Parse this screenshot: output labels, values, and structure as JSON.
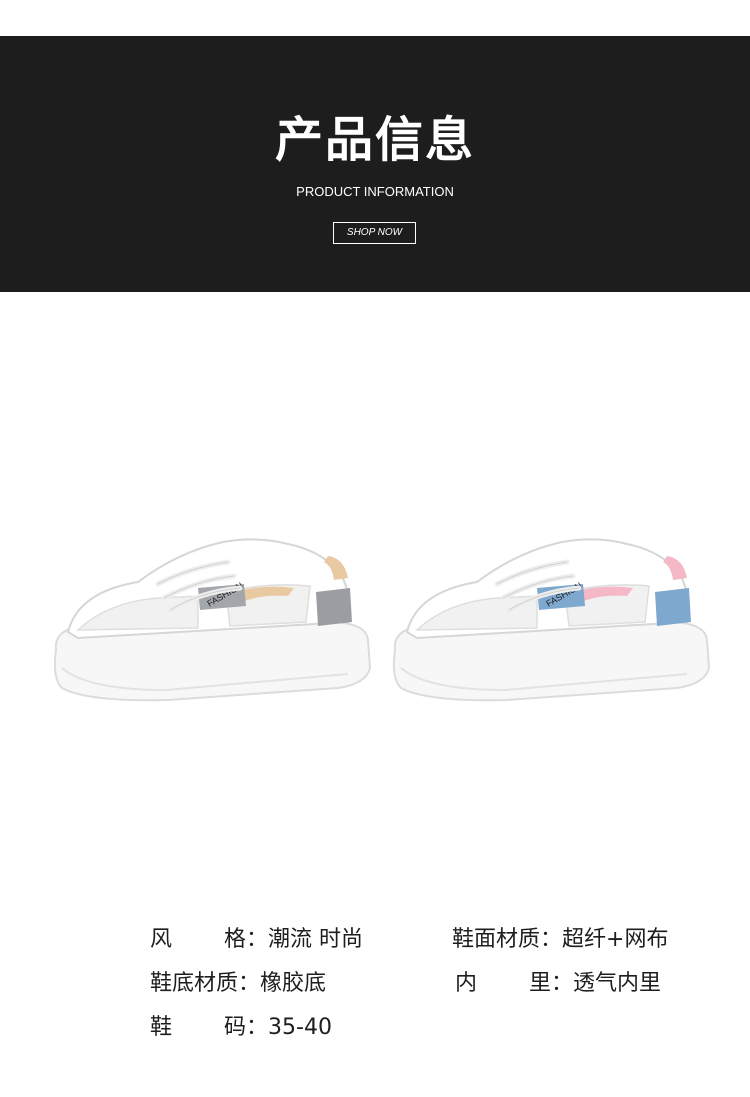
{
  "banner": {
    "title": "产品信息",
    "subtitle": "PRODUCT INFORMATION",
    "button_label": "SHOP NOW"
  },
  "products": [
    {
      "tag": "FASHION",
      "accent": "#e9c9a2",
      "heel": "#9a9da1"
    },
    {
      "tag": "FASHION",
      "accent": "#f4b8c6",
      "heel": "#7fa8cf"
    }
  ],
  "specs": {
    "style": {
      "label_a": "风",
      "label_b": "格",
      "colon": "：",
      "value": "潮流 时尚"
    },
    "upper": {
      "label": "鞋面材质",
      "colon": "：",
      "value": "超纤+网布"
    },
    "sole": {
      "label": "鞋底材质",
      "colon": "：",
      "value": "橡胶底"
    },
    "lining": {
      "label_a": "内",
      "label_b": "里",
      "colon": "：",
      "value": "透气内里"
    },
    "size": {
      "label_a": "鞋",
      "label_b": "码",
      "colon": "：",
      "value": "35-40"
    }
  }
}
